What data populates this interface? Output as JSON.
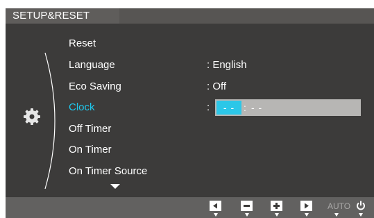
{
  "title": "SETUP&RESET",
  "menu": {
    "items": [
      {
        "label": "Reset",
        "value": ""
      },
      {
        "label": "Language",
        "value": ": English"
      },
      {
        "label": "Eco Saving",
        "value": ": Off"
      },
      {
        "label": "Clock",
        "value": ""
      },
      {
        "label": "Off Timer",
        "value": ""
      },
      {
        "label": "On Timer",
        "value": ""
      },
      {
        "label": "On Timer Source",
        "value": ""
      }
    ],
    "selected_index": 3
  },
  "clock": {
    "colon": ":",
    "hour": "- -",
    "separator": ":",
    "minute": "- -"
  },
  "buttons": {
    "auto_label": "AUTO"
  },
  "icons": [
    "gear-icon",
    "scroll-down-arrow-icon",
    "left-arrow-icon",
    "minus-icon",
    "plus-icon",
    "right-arrow-icon",
    "power-icon"
  ],
  "colors": {
    "accent": "#1fc8ed",
    "background": "#3c3b3a",
    "title_bar": "#575553",
    "bottom_bar": "#626160",
    "field": "#b7b6b4"
  }
}
